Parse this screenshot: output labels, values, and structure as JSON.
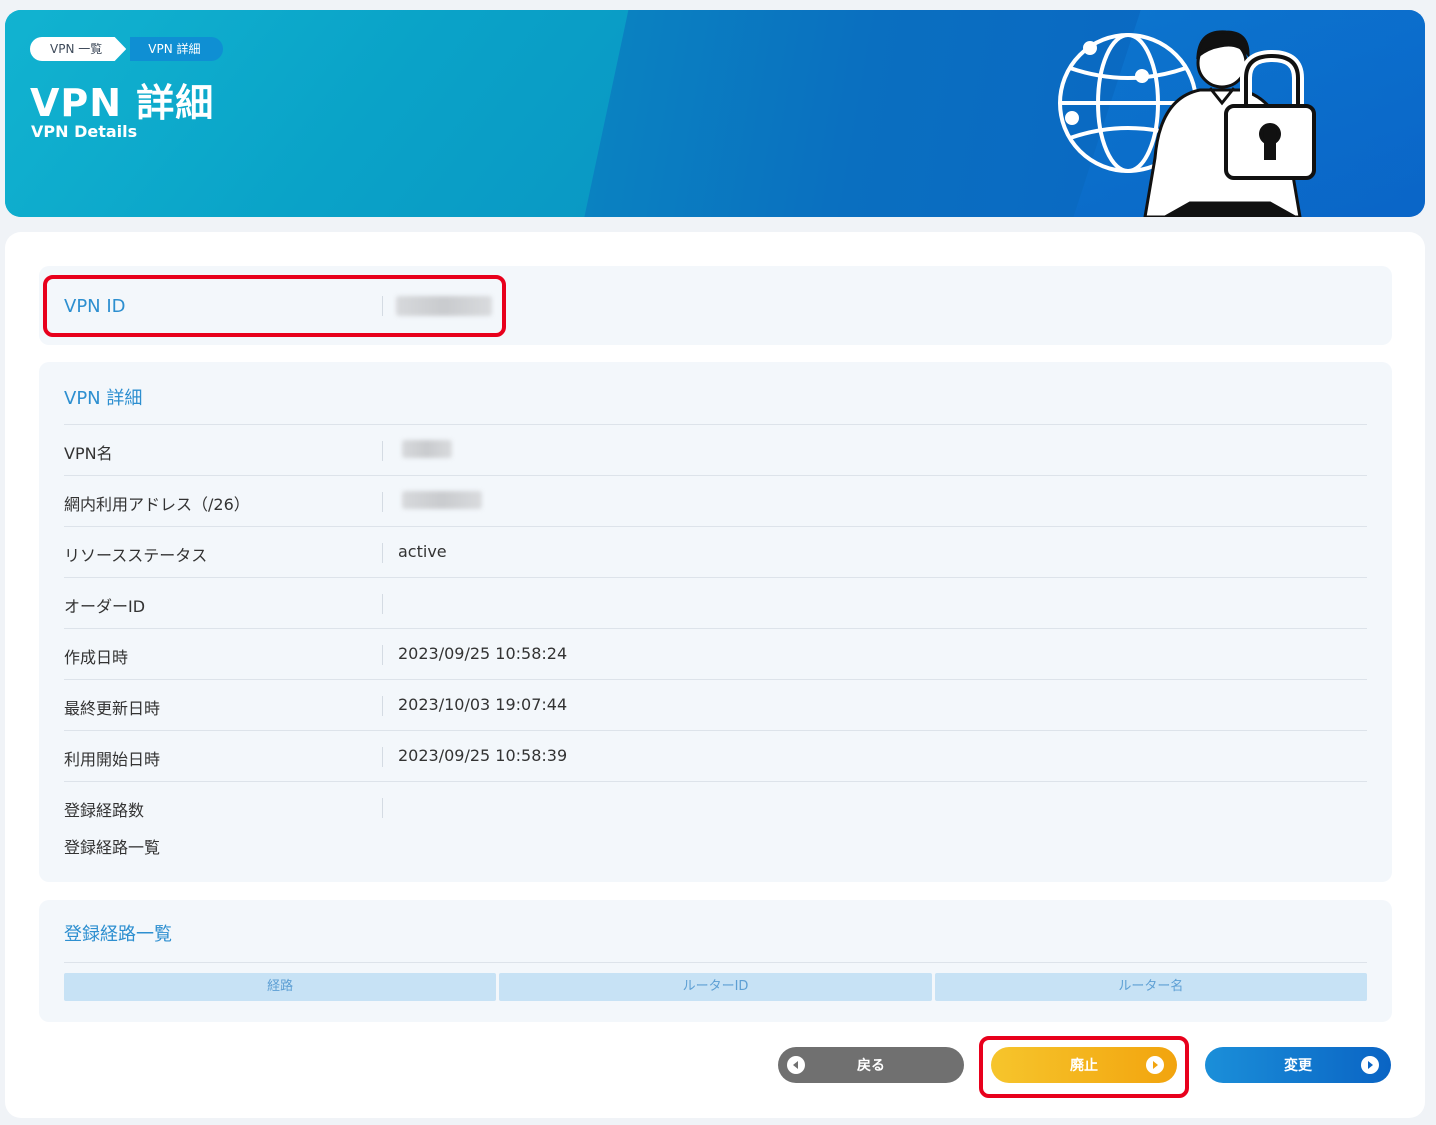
{
  "breadcrumb": {
    "items": [
      {
        "label": "VPN 一覧"
      },
      {
        "label": "VPN 詳細"
      }
    ]
  },
  "header": {
    "title": "VPN 詳細",
    "subtitle": "VPN Details"
  },
  "vpn_id": {
    "label": "VPN ID"
  },
  "details": {
    "section_title": "VPN 詳細",
    "rows": [
      {
        "label": "VPN名",
        "value": ""
      },
      {
        "label": "網内利用アドレス（/26）",
        "value": ""
      },
      {
        "label": "リソースステータス",
        "value": "active"
      },
      {
        "label": "オーダーID",
        "value": ""
      },
      {
        "label": "作成日時",
        "value": "2023/09/25 10:58:24"
      },
      {
        "label": "最終更新日時",
        "value": "2023/10/03 19:07:44"
      },
      {
        "label": "利用開始日時",
        "value": "2023/09/25 10:58:39"
      },
      {
        "label": "登録経路数",
        "value": ""
      }
    ],
    "routes_list_label": "登録経路一覧"
  },
  "routes": {
    "section_title": "登録経路一覧",
    "columns": [
      "経路",
      "ルーターID",
      "ルーター名"
    ],
    "rows": []
  },
  "buttons": {
    "back": "戻る",
    "abolish": "廃止",
    "change": "変更"
  },
  "colors": {
    "accent_blue": "#2d8fd0",
    "highlight_red": "#e8001c",
    "abolish_yellow": "#f6c52c",
    "change_blue": "#0a64c4",
    "back_gray": "#707070"
  }
}
